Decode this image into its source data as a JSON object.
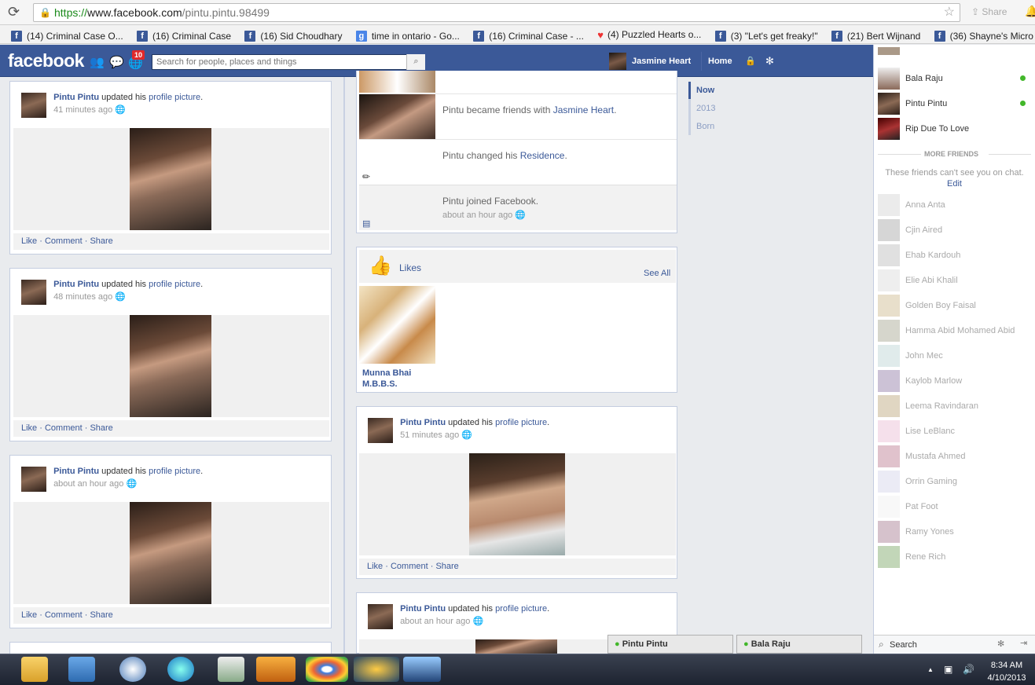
{
  "browser": {
    "url_scheme": "https://",
    "url_host": "www.facebook.com",
    "url_path": "/pintu.pintu.98499",
    "share_label": "Share",
    "bookmarks": [
      "(14) Criminal Case O...",
      "(16) Criminal Case",
      "(16) Sid Choudhary",
      "time in ontario - Go...",
      "(16) Criminal Case - ...",
      "(4) Puzzled Hearts o...",
      "(3) \"Let's get freaky!\"",
      "(21) Bert Wijnand",
      "(36) Shayne's Micro ..."
    ]
  },
  "fb": {
    "logo": "facebook",
    "notif_count": "10",
    "search_placeholder": "Search for people, places and things",
    "user_name": "Jasmine Heart",
    "home_label": "Home"
  },
  "left_posts": [
    {
      "name": "Pintu Pintu",
      "verb": "updated his",
      "link": "profile picture",
      "time": "41 minutes ago"
    },
    {
      "name": "Pintu Pintu",
      "verb": "updated his",
      "link": "profile picture",
      "time": "48 minutes ago"
    },
    {
      "name": "Pintu Pintu",
      "verb": "updated his",
      "link": "profile picture",
      "time": "about an hour ago"
    }
  ],
  "actions": {
    "like": "Like",
    "comment": "Comment",
    "share": "Share"
  },
  "life_events": {
    "friends_prefix": "Pintu became friends with",
    "friends_name": "Jasmine Heart",
    "residence_prefix": "Pintu changed his",
    "residence_link": "Residence",
    "joined": "Pintu joined Facebook.",
    "joined_time": "about an hour ago"
  },
  "likes": {
    "title": "Likes",
    "see_all": "See All",
    "item_line1": "Munna Bhai",
    "item_line2": "M.B.B.S."
  },
  "right_posts": [
    {
      "name": "Pintu Pintu",
      "verb": "updated his",
      "link": "profile picture",
      "time": "51 minutes ago"
    },
    {
      "name": "Pintu Pintu",
      "verb": "updated his",
      "link": "profile picture",
      "time": "about an hour ago"
    }
  ],
  "scrubber": [
    "Now",
    "2013",
    "Born"
  ],
  "sidebar": {
    "online": [
      "Bala Raju",
      "Pintu Pintu",
      "Rip Due To Love"
    ],
    "more_friends_title": "MORE FRIENDS",
    "more_friends_note": "These friends can't see you on chat.",
    "edit_label": "Edit",
    "offline": [
      "Anna Anta",
      "Cjin Aired",
      "Ehab Kardouh",
      "Elie Abi Khalil",
      "Golden Boy Faisal",
      "Hamma Abid Mohamed Abid",
      "John Mec",
      "Kaylob Marlow",
      "Leema Ravindaran",
      "Lise LeBlanc",
      "Mustafa Ahmed",
      "Orrin Gaming",
      "Pat Foot",
      "Ramy Yones",
      "Rene Rich"
    ],
    "search_label": "Search"
  },
  "chat_tabs": [
    "Pintu Pintu",
    "Bala Raju"
  ],
  "taskbar": {
    "time": "8:34 AM",
    "date": "4/10/2013"
  },
  "colors": {
    "fb_blue": "#3b5998",
    "online_green": "#42b72a"
  }
}
